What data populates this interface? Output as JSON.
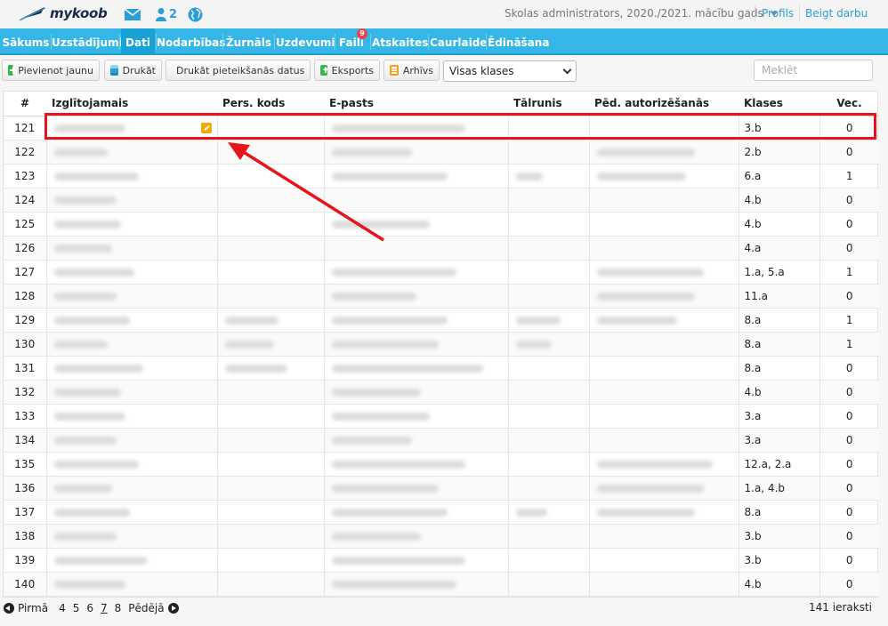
{
  "header": {
    "logo_text": "mykoob",
    "users_count": "2",
    "school_year": "Skolas administrators, 2020./2021. mācību gads",
    "profile_link": "Profils",
    "logout_link": "Beigt darbu"
  },
  "nav": {
    "items": [
      {
        "label": "Sākums"
      },
      {
        "label": "Uzstādījumi"
      },
      {
        "label": "Dati"
      },
      {
        "label": "Nodarbības"
      },
      {
        "label": "Žurnāls"
      },
      {
        "label": "Uzdevumi"
      },
      {
        "label": "Faili"
      },
      {
        "label": "Atskaites"
      },
      {
        "label": "Caurlaide"
      },
      {
        "label": "Ēdināšana"
      }
    ],
    "files_badge": "9",
    "active": "Dati"
  },
  "toolbar": {
    "add_label": "Pievienot jaunu",
    "print_label": "Drukāt",
    "print_login_label": "Drukāt pieteikšanās datus",
    "export_label": "Eksports",
    "archive_label": "Arhīvs",
    "class_filter": "Visas klases",
    "search_placeholder": "Meklēt"
  },
  "table": {
    "headers": {
      "num": "#",
      "student": "Izglītojamais",
      "pers_code": "Pers. kods",
      "email": "E-pasts",
      "phone": "Tālrunis",
      "last_auth": "Pēd. autorizēšanās",
      "class": "Klases",
      "vec": "Vec."
    },
    "rows": [
      {
        "num": "121",
        "class": "3.b",
        "vec": "0"
      },
      {
        "num": "122",
        "class": "2.b",
        "vec": "0"
      },
      {
        "num": "123",
        "class": "6.a",
        "vec": "1"
      },
      {
        "num": "124",
        "class": "4.b",
        "vec": "0"
      },
      {
        "num": "125",
        "class": "4.b",
        "vec": "0"
      },
      {
        "num": "126",
        "class": "4.a",
        "vec": "0"
      },
      {
        "num": "127",
        "class": "1.a, 5.a",
        "vec": "1"
      },
      {
        "num": "128",
        "class": "11.a",
        "vec": "0"
      },
      {
        "num": "129",
        "class": "8.a",
        "vec": "1"
      },
      {
        "num": "130",
        "class": "8.a",
        "vec": "1"
      },
      {
        "num": "131",
        "class": "8.a",
        "vec": "0"
      },
      {
        "num": "132",
        "class": "4.b",
        "vec": "0"
      },
      {
        "num": "133",
        "class": "3.a",
        "vec": "0"
      },
      {
        "num": "134",
        "class": "3.a",
        "vec": "0"
      },
      {
        "num": "135",
        "class": "12.a, 2.a",
        "vec": "0"
      },
      {
        "num": "136",
        "class": "1.a, 4.b",
        "vec": "0"
      },
      {
        "num": "137",
        "class": "8.a",
        "vec": "0"
      },
      {
        "num": "138",
        "class": "3.b",
        "vec": "0"
      },
      {
        "num": "139",
        "class": "3.b",
        "vec": "0"
      },
      {
        "num": "140",
        "class": "4.b",
        "vec": "0"
      }
    ]
  },
  "pager": {
    "first_label": "Pirmā",
    "pages": [
      "4",
      "5",
      "6",
      "7",
      "8"
    ],
    "current": "7",
    "last_label": "Pēdējā",
    "total_label": "141 ieraksti"
  },
  "colors": {
    "nav_bg": "#35b6e6",
    "nav_active": "#19a2d6",
    "link": "#2a9fd6",
    "highlight": "#e8141b",
    "badge": "#e8454a",
    "edit_icon": "#f2a900"
  }
}
